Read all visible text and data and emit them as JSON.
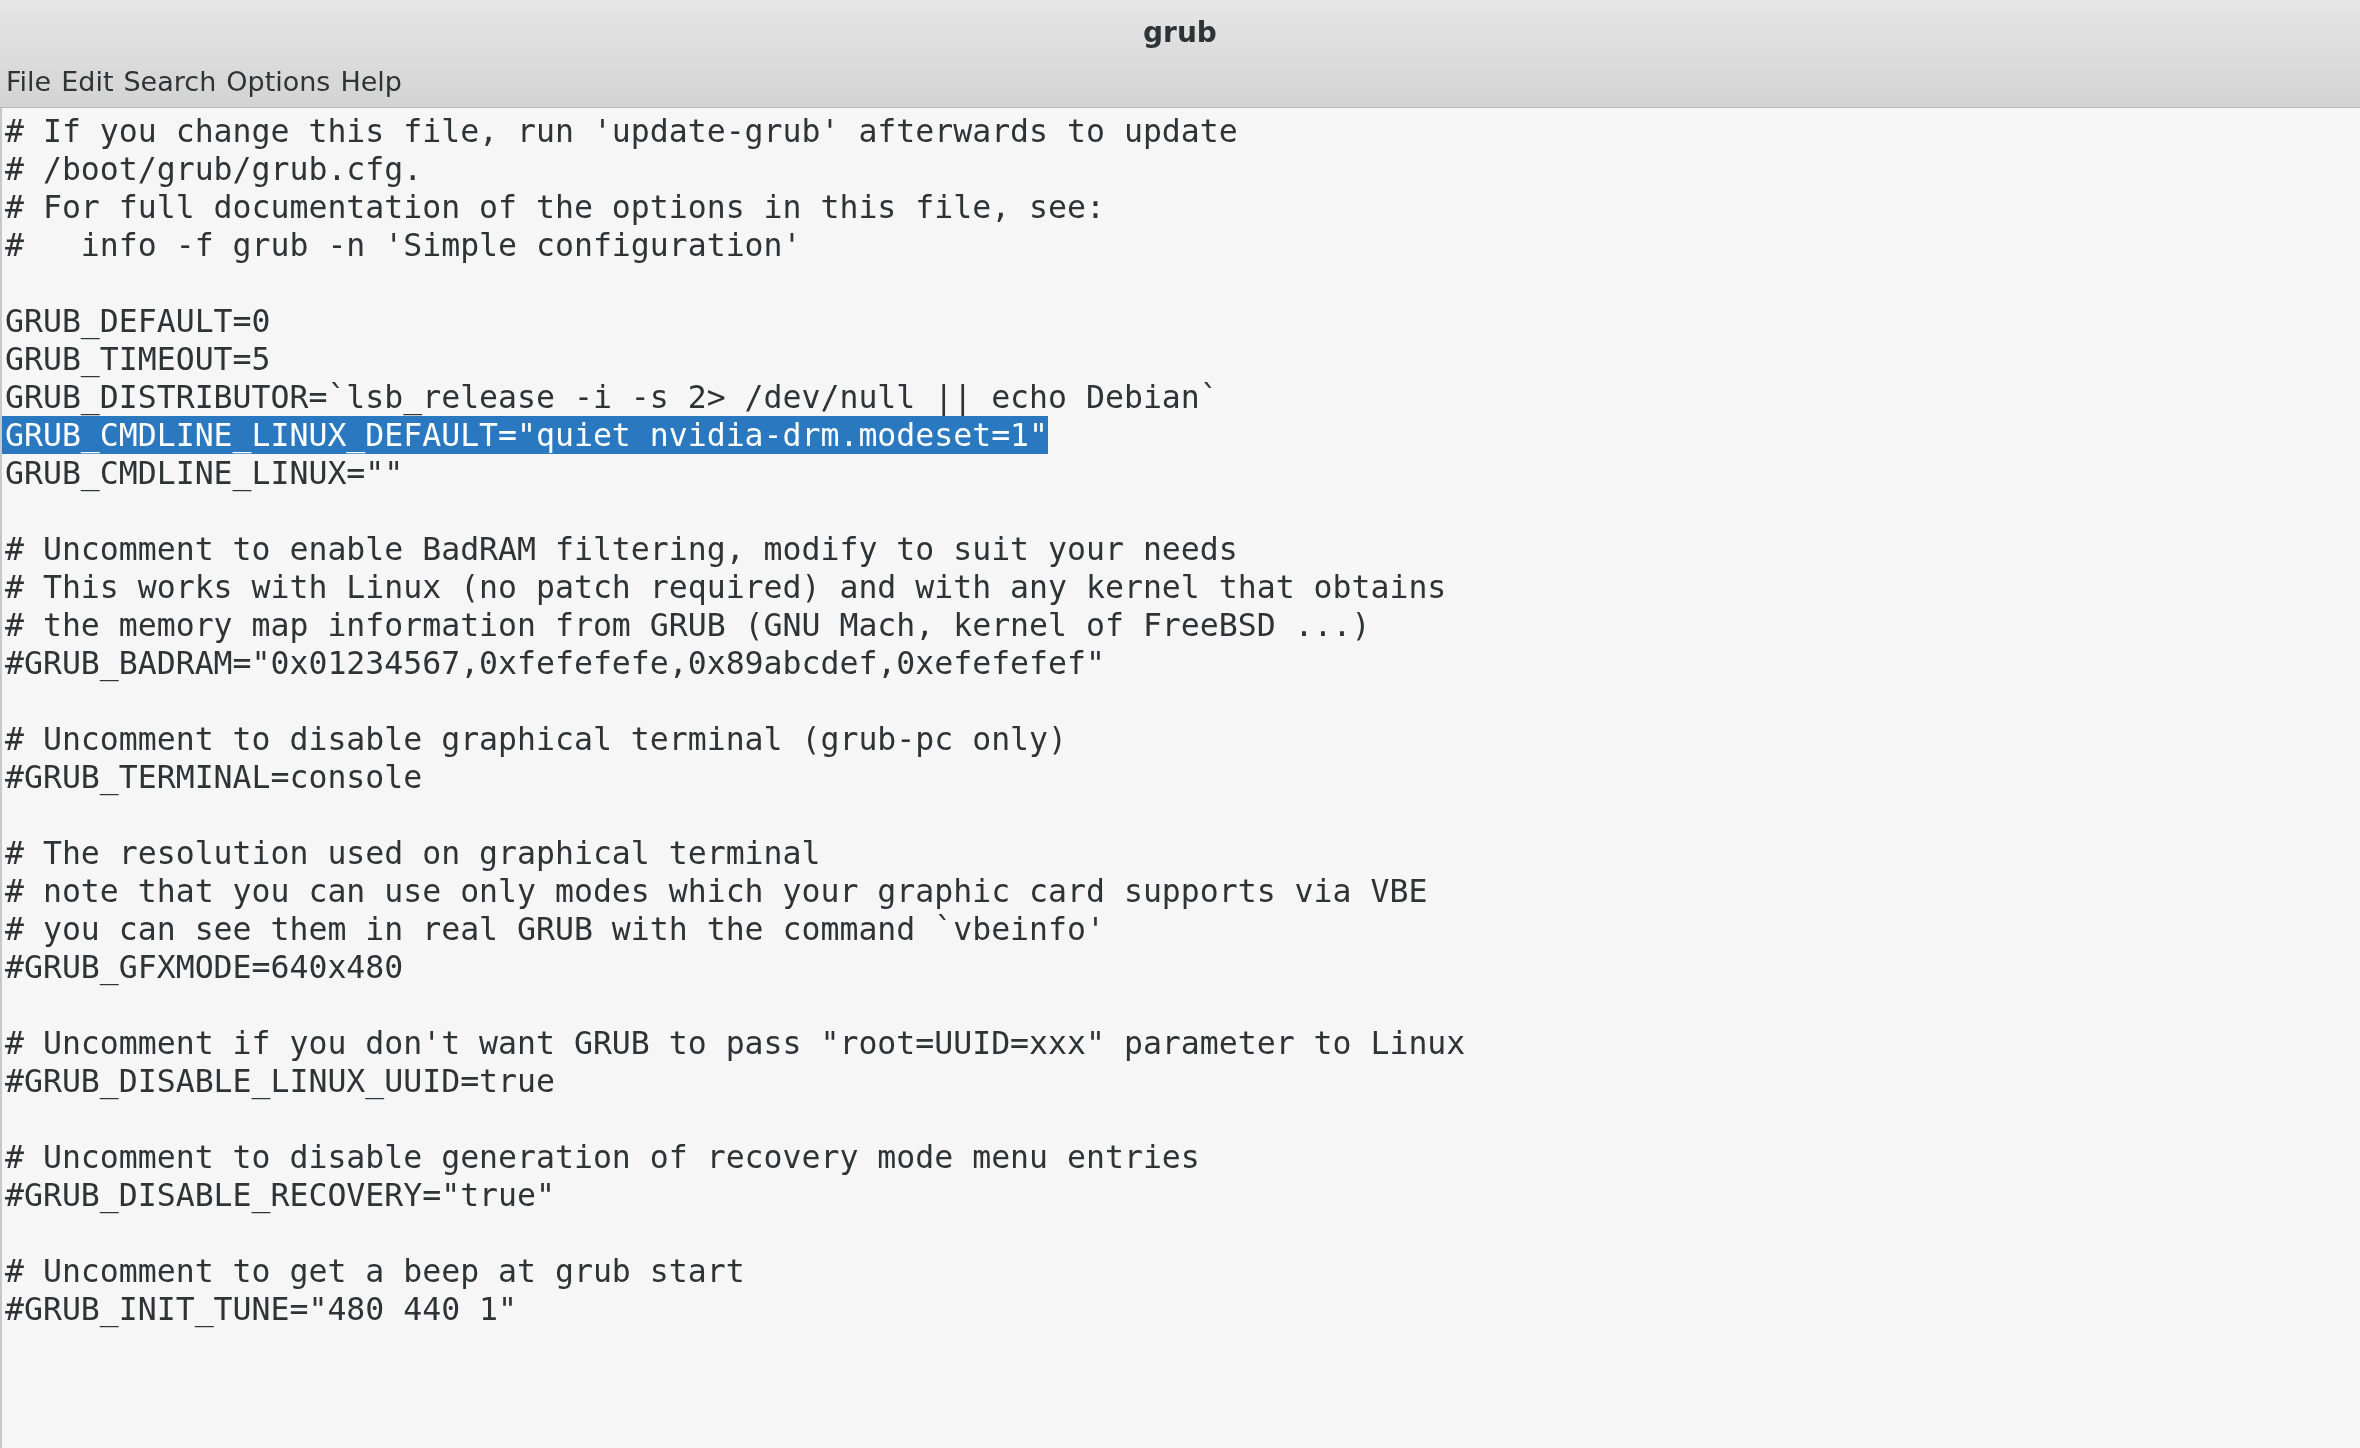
{
  "window": {
    "title": "grub"
  },
  "menu": [
    "File",
    "Edit",
    "Search",
    "Options",
    "Help"
  ],
  "blocks": [
    [
      {
        "text": "# If you change this file, run 'update-grub' afterwards to update",
        "selected": false
      },
      {
        "text": "# /boot/grub/grub.cfg.",
        "selected": false
      },
      {
        "text": "# For full documentation of the options in this file, see:",
        "selected": false
      },
      {
        "text": "#   info -f grub -n 'Simple configuration'",
        "selected": false
      }
    ],
    [
      {
        "text": "GRUB_DEFAULT=0",
        "selected": false
      },
      {
        "text": "GRUB_TIMEOUT=5",
        "selected": false
      },
      {
        "text": "GRUB_DISTRIBUTOR=`lsb_release -i -s 2> /dev/null || echo Debian`",
        "selected": false
      },
      {
        "text": "GRUB_CMDLINE_LINUX_DEFAULT=\"quiet nvidia-drm.modeset=1\"",
        "selected": true
      },
      {
        "text": "GRUB_CMDLINE_LINUX=\"\"",
        "selected": false
      }
    ],
    [
      {
        "text": "# Uncomment to enable BadRAM filtering, modify to suit your needs",
        "selected": false
      },
      {
        "text": "# This works with Linux (no patch required) and with any kernel that obtains",
        "selected": false
      },
      {
        "text": "# the memory map information from GRUB (GNU Mach, kernel of FreeBSD ...)",
        "selected": false
      },
      {
        "text": "#GRUB_BADRAM=\"0x01234567,0xfefefefe,0x89abcdef,0xefefefef\"",
        "selected": false
      }
    ],
    [
      {
        "text": "# Uncomment to disable graphical terminal (grub-pc only)",
        "selected": false
      },
      {
        "text": "#GRUB_TERMINAL=console",
        "selected": false
      }
    ],
    [
      {
        "text": "# The resolution used on graphical terminal",
        "selected": false
      },
      {
        "text": "# note that you can use only modes which your graphic card supports via VBE",
        "selected": false
      },
      {
        "text": "# you can see them in real GRUB with the command `vbeinfo'",
        "selected": false
      },
      {
        "text": "#GRUB_GFXMODE=640x480",
        "selected": false
      }
    ],
    [
      {
        "text": "# Uncomment if you don't want GRUB to pass \"root=UUID=xxx\" parameter to Linux",
        "selected": false
      },
      {
        "text": "#GRUB_DISABLE_LINUX_UUID=true",
        "selected": false
      }
    ],
    [
      {
        "text": "# Uncomment to disable generation of recovery mode menu entries",
        "selected": false
      },
      {
        "text": "#GRUB_DISABLE_RECOVERY=\"true\"",
        "selected": false
      }
    ],
    [
      {
        "text": "# Uncomment to get a beep at grub start",
        "selected": false
      },
      {
        "text": "#GRUB_INIT_TUNE=\"480 440 1\"",
        "selected": false
      }
    ]
  ]
}
